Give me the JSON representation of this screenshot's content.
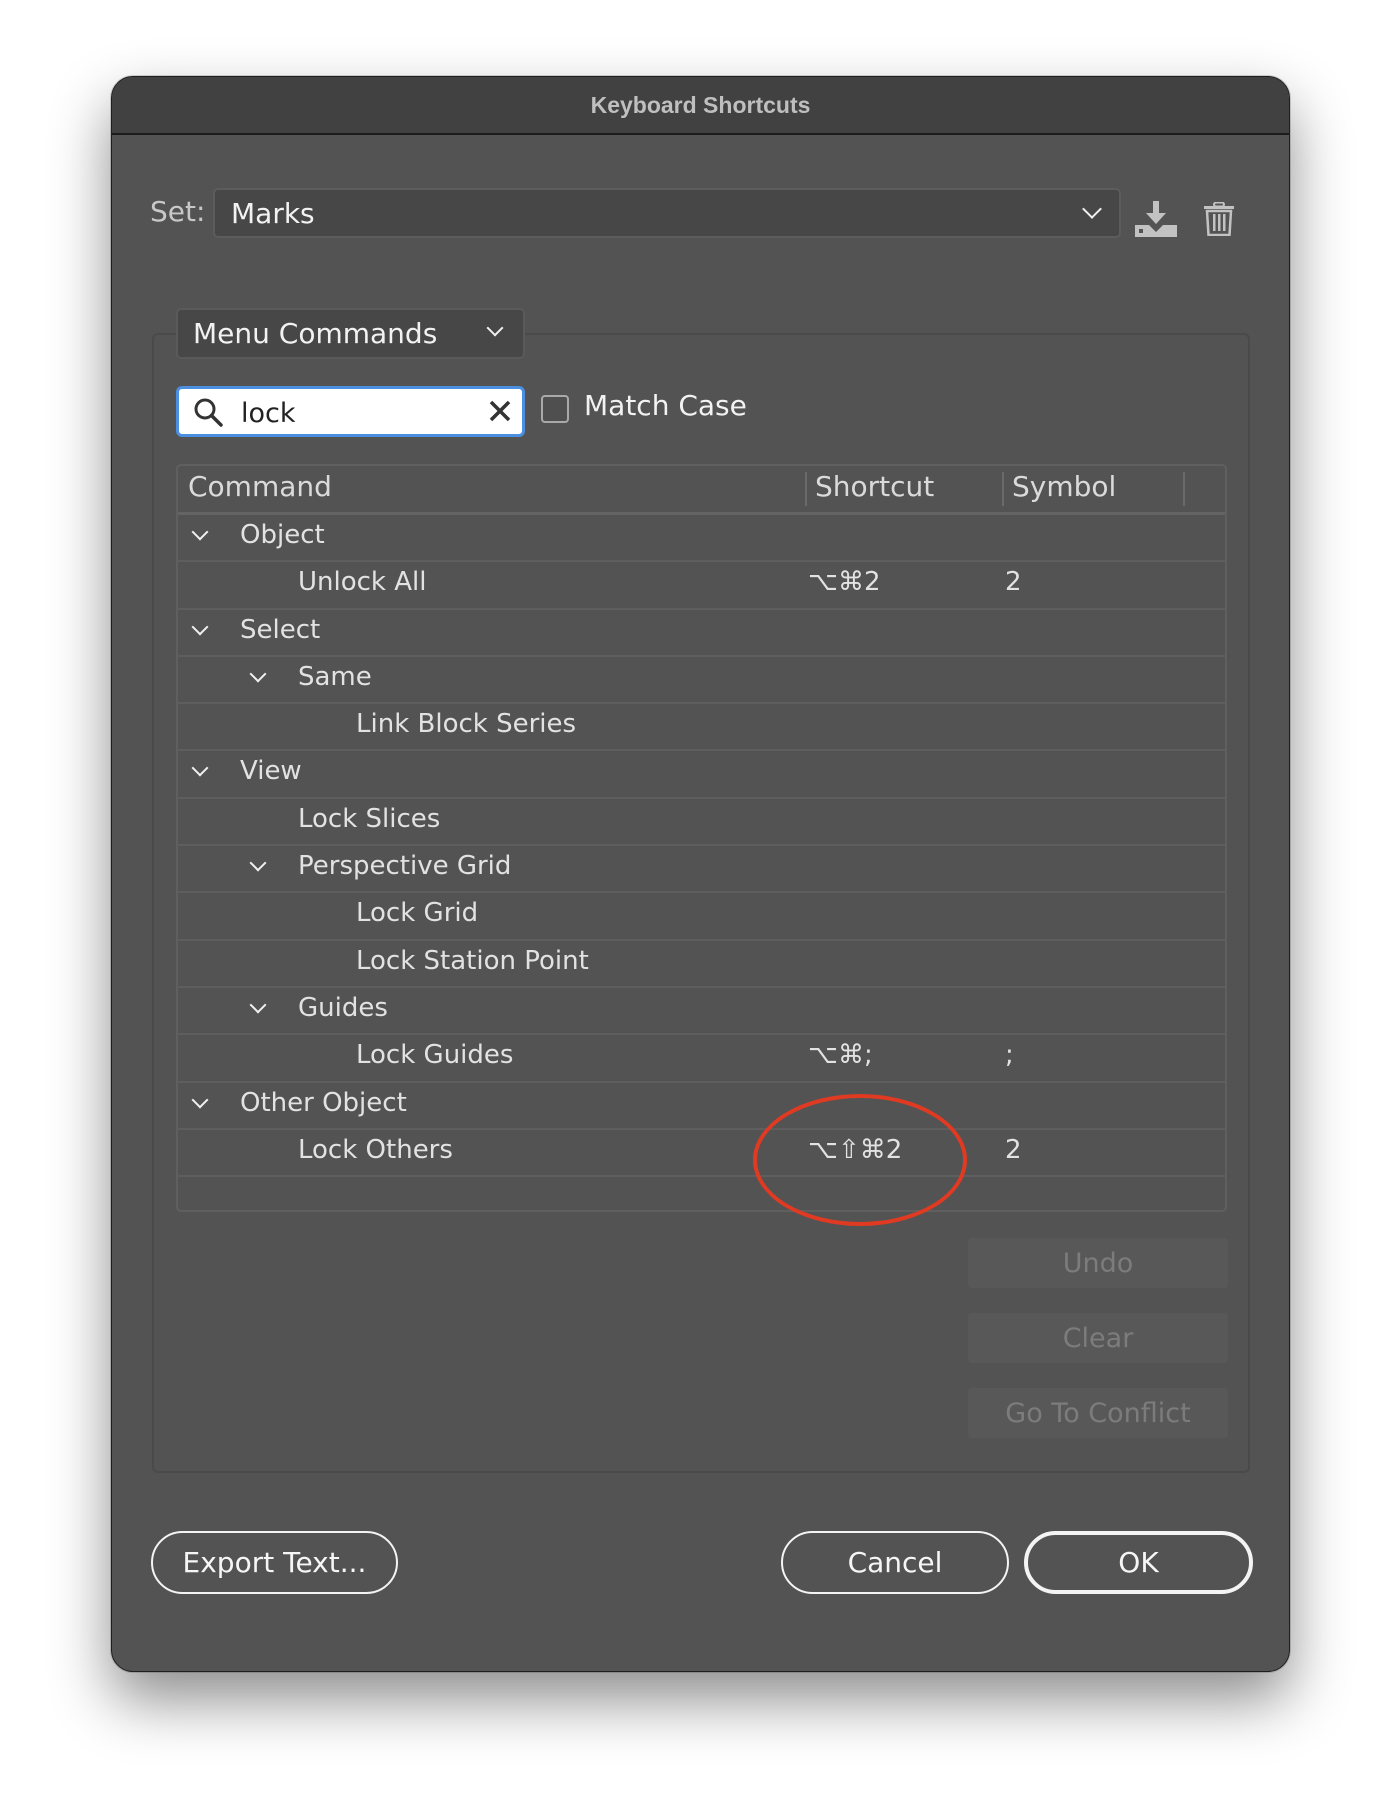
{
  "window": {
    "title": "Keyboard Shortcuts"
  },
  "set": {
    "label": "Set:",
    "value": "Marks",
    "save_icon": "save-set-icon",
    "delete_icon": "trash-icon"
  },
  "category": {
    "value": "Menu Commands"
  },
  "search": {
    "value": "lock",
    "placeholder": ""
  },
  "match_case": {
    "label": "Match Case",
    "checked": false
  },
  "table": {
    "columns": [
      "Command",
      "Shortcut",
      "Symbol"
    ],
    "rows": [
      {
        "level": 0,
        "expandable": true,
        "command": "Object",
        "shortcut": "",
        "symbol": ""
      },
      {
        "level": 1,
        "expandable": false,
        "command": "Unlock All",
        "shortcut": "⌥⌘2",
        "symbol": "2"
      },
      {
        "level": 0,
        "expandable": true,
        "command": "Select",
        "shortcut": "",
        "symbol": ""
      },
      {
        "level": 1,
        "expandable": true,
        "command": "Same",
        "shortcut": "",
        "symbol": ""
      },
      {
        "level": 2,
        "expandable": false,
        "command": "Link Block Series",
        "shortcut": "",
        "symbol": ""
      },
      {
        "level": 0,
        "expandable": true,
        "command": "View",
        "shortcut": "",
        "symbol": ""
      },
      {
        "level": 1,
        "expandable": false,
        "command": "Lock Slices",
        "shortcut": "",
        "symbol": ""
      },
      {
        "level": 1,
        "expandable": true,
        "command": "Perspective Grid",
        "shortcut": "",
        "symbol": ""
      },
      {
        "level": 2,
        "expandable": false,
        "command": "Lock Grid",
        "shortcut": "",
        "symbol": ""
      },
      {
        "level": 2,
        "expandable": false,
        "command": "Lock Station Point",
        "shortcut": "",
        "symbol": ""
      },
      {
        "level": 1,
        "expandable": true,
        "command": "Guides",
        "shortcut": "",
        "symbol": ""
      },
      {
        "level": 2,
        "expandable": false,
        "command": "Lock Guides",
        "shortcut": "⌥⌘;",
        "symbol": ";"
      },
      {
        "level": 0,
        "expandable": true,
        "command": "Other Object",
        "shortcut": "",
        "symbol": ""
      },
      {
        "level": 1,
        "expandable": false,
        "command": "Lock Others",
        "shortcut": "⌥⇧⌘2",
        "symbol": "2"
      }
    ]
  },
  "annotation": {
    "shape": "ellipse",
    "target": "Lock Others shortcut",
    "color": "#e03a22"
  },
  "side_buttons": {
    "undo": "Undo",
    "clear": "Clear",
    "go_to_conflict": "Go To Conflict"
  },
  "footer": {
    "export": "Export Text...",
    "cancel": "Cancel",
    "ok": "OK"
  }
}
